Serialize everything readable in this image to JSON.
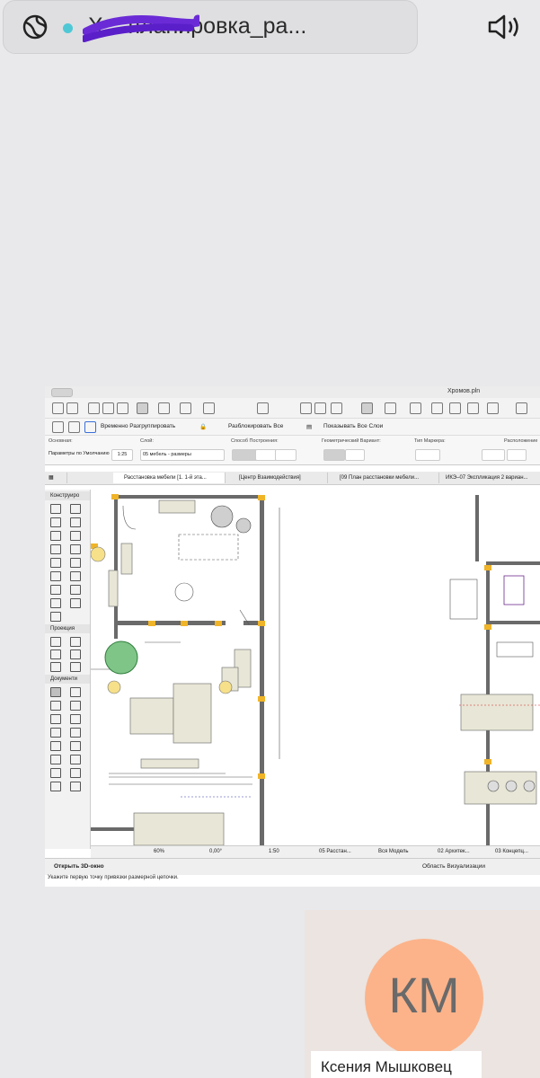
{
  "call": {
    "title": "Х... планировка_ра...",
    "status_color": "#4fc8d6"
  },
  "archicad": {
    "file_title": "Хромов.pln",
    "toolbar2": {
      "ungroup_temp": "Временно Разгруппировать",
      "unlock_all": "Разблокировать Все",
      "show_all_layers": "Показывать Все Слои"
    },
    "info": {
      "main_label": "Основная:",
      "layer_label": "Слой:",
      "method_label": "Способ Построения:",
      "geometry_label": "Геометрический Вариант:",
      "marker_label": "Тип Маркера:",
      "placement_label": "Расположение",
      "default_params": "Параметры по Умолчанию",
      "layer_value": "05 мебель - размеры",
      "scale_small": "1:25"
    },
    "tabs": [
      "Расстановка мебели [1. 1-й эта...",
      "[Центр Взаимодействия]",
      "[09 План расстановки мебели...",
      "ИКЭ–07 Экспликация 2 вариан..."
    ],
    "palette": {
      "construct": "Конструиро",
      "projection": "Проекция",
      "documents": "Документи"
    },
    "status": {
      "zoom": "60%",
      "angle": "0,00°",
      "scale": "1:50",
      "layer_combo": "05 Расстан...",
      "model": "Вся Модель",
      "arch": "02 Архитек...",
      "concept": "03 Концепц..."
    },
    "bottom": {
      "open3d": "Открыть 3D-окно",
      "visual": "Область Визуализации"
    },
    "hint": "Укажите первую точку привязки размерной цепочки."
  },
  "participant": {
    "initials": "КМ",
    "name": "Ксения Мышковец",
    "avatar_color": "#fcb38a"
  }
}
